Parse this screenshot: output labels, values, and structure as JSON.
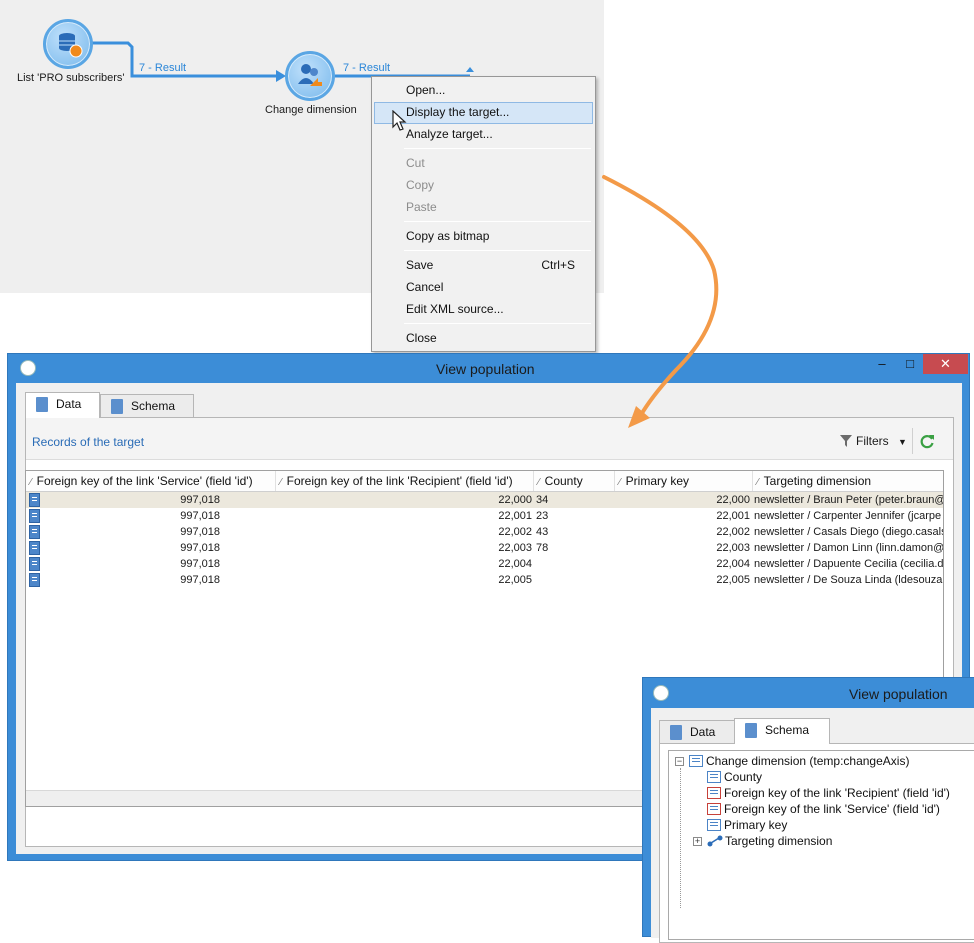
{
  "workflow": {
    "node_list": {
      "label": "List 'PRO subscribers'",
      "icon": "database-icon"
    },
    "node_change": {
      "label": "Change dimension",
      "icon": "change-dimension-icon"
    },
    "wire1_label": "7 - Result",
    "wire2_label": "7 - Result"
  },
  "context_menu": {
    "items": [
      {
        "label": "Open...",
        "enabled": true
      },
      {
        "label": "Display the target...",
        "enabled": true,
        "highlighted": true
      },
      {
        "label": "Analyze target...",
        "enabled": true
      },
      {
        "label": "Cut",
        "enabled": false
      },
      {
        "label": "Copy",
        "enabled": false
      },
      {
        "label": "Paste",
        "enabled": false
      },
      {
        "label": "Copy as bitmap",
        "enabled": true
      },
      {
        "label": "Save",
        "enabled": true,
        "shortcut": "Ctrl+S"
      },
      {
        "label": "Cancel",
        "enabled": true
      },
      {
        "label": "Edit XML source...",
        "enabled": true
      },
      {
        "label": "Close",
        "enabled": true
      }
    ]
  },
  "window_data": {
    "title": "View population",
    "tabs": [
      {
        "label": "Data",
        "active": true
      },
      {
        "label": "Schema",
        "active": false
      }
    ],
    "section_title": "Records of the target",
    "filters_label": "Filters",
    "columns": [
      "Foreign key of the link 'Service' (field 'id')",
      "Foreign key of the link 'Recipient' (field 'id')",
      "County",
      "Primary key",
      "Targeting dimension"
    ],
    "rows": [
      [
        "997,018",
        "22,000",
        "34",
        "22,000",
        "newsletter / Braun Peter (peter.braun@"
      ],
      [
        "997,018",
        "22,001",
        "23",
        "22,001",
        "newsletter / Carpenter Jennifer (jcarpe"
      ],
      [
        "997,018",
        "22,002",
        "43",
        "22,002",
        "newsletter / Casals Diego (diego.casals"
      ],
      [
        "997,018",
        "22,003",
        "78",
        "22,003",
        "newsletter / Damon Linn (linn.damon@"
      ],
      [
        "997,018",
        "22,004",
        "",
        "22,004",
        "newsletter / Dapuente Cecilia (cecilia.da"
      ],
      [
        "997,018",
        "22,005",
        "",
        "22,005",
        "newsletter / De Souza Linda (ldesouza@"
      ]
    ]
  },
  "window_schema": {
    "title": "View population",
    "tabs": [
      {
        "label": "Data",
        "active": false
      },
      {
        "label": "Schema",
        "active": true
      }
    ],
    "tree": {
      "root": "Change dimension (temp:changeAxis)",
      "children": [
        {
          "label": "County",
          "icon": "field-icon"
        },
        {
          "label": "Foreign key of the link 'Recipient' (field 'id')",
          "icon": "foreign-key-icon"
        },
        {
          "label": "Foreign key of the link 'Service' (field 'id')",
          "icon": "foreign-key-icon"
        },
        {
          "label": "Primary key",
          "icon": "field-icon"
        },
        {
          "label": "Targeting dimension",
          "icon": "link-icon"
        }
      ]
    }
  },
  "colors": {
    "accent": "#3c8dd7",
    "link_text": "#2a6cb6",
    "arrow": "#f39a48",
    "close_button": "#c74b50"
  }
}
